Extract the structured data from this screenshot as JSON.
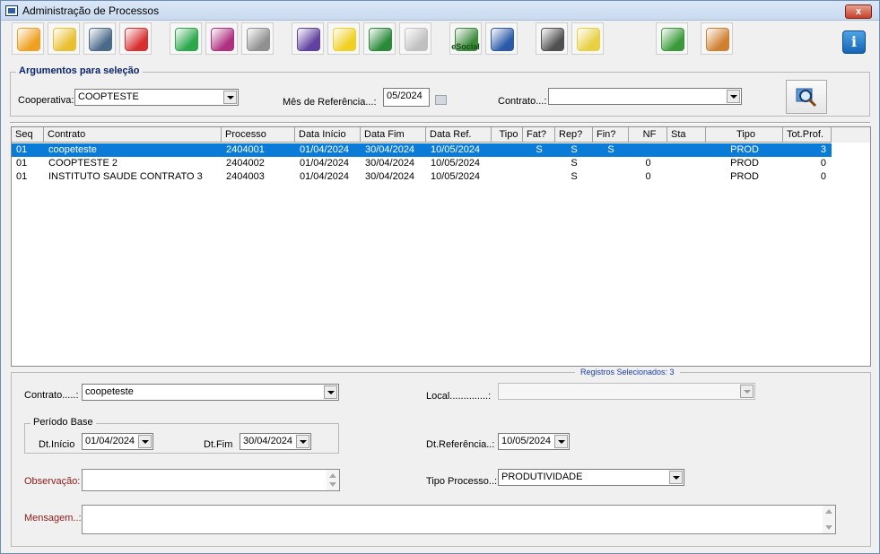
{
  "window": {
    "title": "Administração de Processos",
    "close_label": "x"
  },
  "toolbar": {
    "buttons": [
      {
        "name": "open-book-icon",
        "color": "#f0a020"
      },
      {
        "name": "folder-arrow-icon",
        "color": "#e8c030"
      },
      {
        "name": "recycle-bin-icon",
        "color": "#4a6a8a"
      },
      {
        "name": "eraser-icon",
        "color": "#d83030"
      },
      {
        "name": "money-bag-icon",
        "color": "#2aa84a"
      },
      {
        "name": "gift-box-icon",
        "color": "#b03080"
      },
      {
        "name": "padlock-open-icon",
        "color": "#909090"
      },
      {
        "name": "bar-chart-icon",
        "color": "#6040a0"
      },
      {
        "name": "warning-icon",
        "color": "#f0d020"
      },
      {
        "name": "check-document-icon",
        "color": "#2a8a3a"
      },
      {
        "name": "globe-user-icon",
        "color": "#c0c0c0"
      },
      {
        "name": "esocial-icon",
        "color": "#3a8a3a"
      },
      {
        "name": "network-emblem-icon",
        "color": "#2a5aa8"
      },
      {
        "name": "pen-paper-icon",
        "color": "#505050"
      },
      {
        "name": "org-chart-icon",
        "color": "#e8d040"
      },
      {
        "name": "disk-arrow-icon",
        "color": "#3a9a3a"
      },
      {
        "name": "edit-document-icon",
        "color": "#d08030"
      }
    ],
    "esocial_label": "eSocial",
    "info_label": "i"
  },
  "selection": {
    "legend": "Argumentos para seleção",
    "cooperativa_label": "Cooperativa:",
    "cooperativa_value": "COOPTESTE",
    "mes_label": "Mês de Referência...:",
    "mes_value": "05/2024",
    "contrato_label": "Contrato...:",
    "contrato_value": ""
  },
  "grid": {
    "columns": [
      "Seq",
      "Contrato",
      "Processo",
      "Data Início",
      "Data Fim",
      "Data Ref.",
      "Tipo",
      "Fat?",
      "Rep?",
      "Fin?",
      "NF",
      "Sta",
      "Tipo",
      "Tot.Prof."
    ],
    "rows": [
      {
        "seq": "01",
        "contrato": "coopeteste",
        "processo": "2404001",
        "inicio": "01/04/2024",
        "fim": "30/04/2024",
        "ref": "10/05/2024",
        "tipo": "",
        "fat": "S",
        "rep": "S",
        "fin": "S",
        "nf": "",
        "sta": "",
        "tipo2": "PROD",
        "tot": "3"
      },
      {
        "seq": "01",
        "contrato": "COOPTESTE 2",
        "processo": "2404002",
        "inicio": "01/04/2024",
        "fim": "30/04/2024",
        "ref": "10/05/2024",
        "tipo": "",
        "fat": "",
        "rep": "S",
        "fin": "",
        "nf": "0",
        "sta": "",
        "tipo2": "PROD",
        "tot": "0"
      },
      {
        "seq": "01",
        "contrato": "INSTITUTO SAUDE CONTRATO 3",
        "processo": "2404003",
        "inicio": "01/04/2024",
        "fim": "30/04/2024",
        "ref": "10/05/2024",
        "tipo": "",
        "fat": "",
        "rep": "S",
        "fin": "",
        "nf": "0",
        "sta": "",
        "tipo2": "PROD",
        "tot": "0"
      }
    ]
  },
  "details": {
    "registros": "Registros Selecionados: 3",
    "contrato_label": "Contrato.....:",
    "contrato_value": "coopeteste",
    "local_label": "Local..............:",
    "local_value": "",
    "periodo_legend": "Período Base",
    "inicio_label": "Dt.Início",
    "inicio_value": "01/04/2024",
    "fim_label": "Dt.Fim",
    "fim_value": "30/04/2024",
    "ref_label": "Dt.Referência..:",
    "ref_value": "10/05/2024",
    "obs_label": "Observação:",
    "obs_value": "",
    "tipo_label": "Tipo Processo..:",
    "tipo_value": "PRODUTIVIDADE",
    "msg_label": "Mensagem..:",
    "msg_value": ""
  }
}
